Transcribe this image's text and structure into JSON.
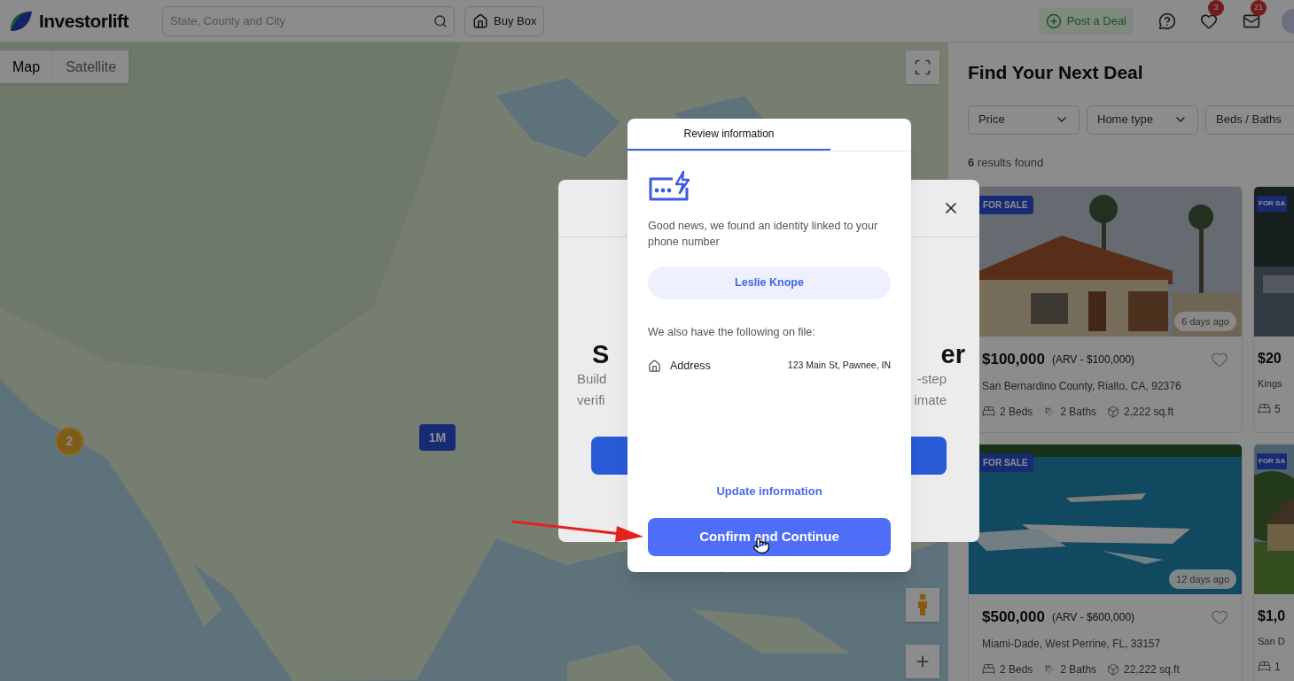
{
  "header": {
    "logo": "Investorlift",
    "search": {
      "placeholder": "State, County and City"
    },
    "buy_box": "Buy Box",
    "post_deal": "Post a Deal",
    "favorites_badge": "3",
    "messages_badge": "21"
  },
  "map": {
    "view_toggle": [
      {
        "label": "Map",
        "selected": true
      },
      {
        "label": "Satellite",
        "selected": false
      }
    ],
    "markers": [
      {
        "kind": "cluster",
        "label": "2"
      },
      {
        "kind": "price",
        "label": "1M"
      }
    ]
  },
  "listings": {
    "title": "Find Your Next Deal",
    "filters": [
      "Price",
      "Home type",
      "Beds / Baths"
    ],
    "results": "**6** results found",
    "cards": [
      {
        "kind": "full",
        "badge": "FOR SALE",
        "age": "6 days ago",
        "price": "$100,000",
        "arv": "(ARV - $100,000)",
        "location": "San Bernardino County, Rialto, CA, 92376",
        "beds": "2 Beds",
        "baths": "2 Baths",
        "area": "2,222 sq.ft"
      },
      {
        "kind": "partial",
        "badge": "FOR SA",
        "price": "$20",
        "location": "Kings",
        "beds": "5"
      },
      {
        "kind": "full",
        "badge": "FOR SALE",
        "age": "12 days ago",
        "price": "$500,000",
        "arv": "(ARV - $600,000)",
        "location": "Miami-Dade, West Perrine, FL, 33157",
        "beds": "2 Beds",
        "baths": "2 Baths",
        "area": "22,222 sq.ft"
      },
      {
        "kind": "partial",
        "badge": "FOR SA",
        "price": "$1,0",
        "location": "San D",
        "beds": "1"
      }
    ]
  },
  "background_dialog": {
    "heading_start": "S",
    "heading_end": "er",
    "text_start": [
      "Build",
      "verifi"
    ],
    "text_end": [
      "-step",
      "imate"
    ]
  },
  "dialog": {
    "tabs": [
      {
        "label": "Review information",
        "selected": true
      }
    ],
    "message": "Good news, we found an identity linked to your phone number",
    "identity": "Leslie Knope",
    "on_file_label": "We also have the following on file:",
    "fields": [
      {
        "label": "Address",
        "value": "123 Main St, Pawnee, IN"
      }
    ],
    "update_link": "Update information",
    "confirm": "Confirm and Continue"
  }
}
